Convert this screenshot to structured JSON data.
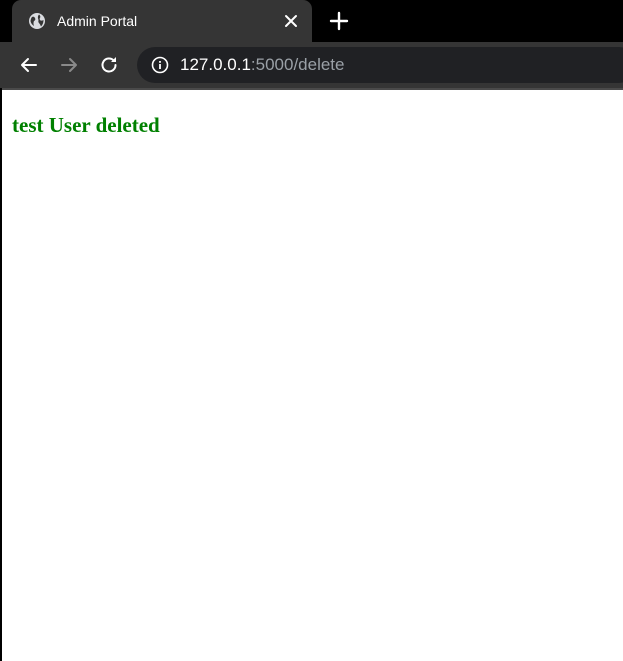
{
  "browser": {
    "tab": {
      "title": "Admin Portal",
      "favicon": "globe-icon"
    },
    "new_tab_icon": "plus-icon",
    "toolbar": {
      "back_icon": "arrow-left-icon",
      "forward_icon": "arrow-right-icon",
      "reload_icon": "reload-icon",
      "info_icon": "info-icon"
    },
    "address_bar": {
      "host": "127.0.0.1",
      "rest": ":5000/delete"
    }
  },
  "page": {
    "message": "test User deleted",
    "message_color": "#008000"
  },
  "colors": {
    "tabstrip_bg": "#000000",
    "tab_bg": "#353535",
    "omnibox_bg": "#202124",
    "url_muted": "#9aa0a6"
  }
}
